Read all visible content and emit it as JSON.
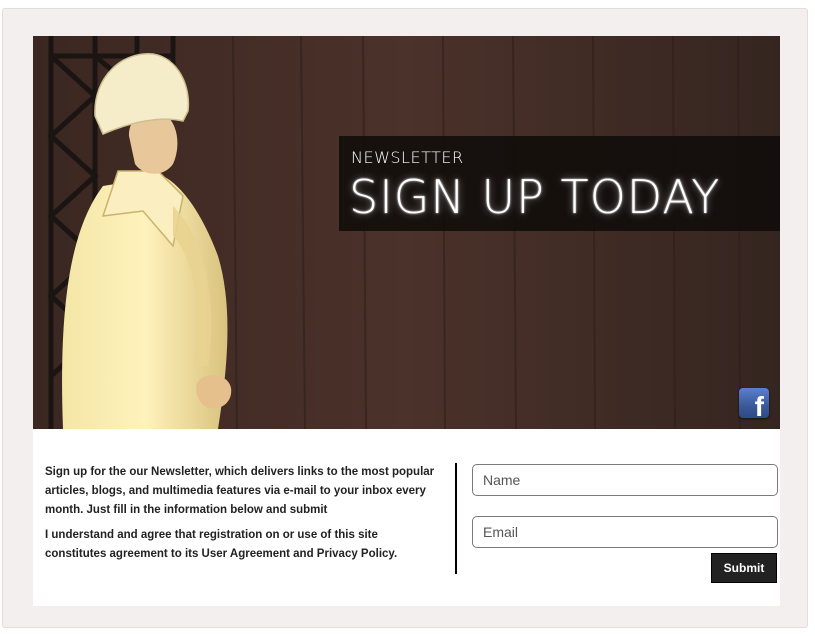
{
  "banner": {
    "kicker": "NEWSLETTER",
    "title": "SIGN UP TODAY"
  },
  "social": {
    "facebook_icon": "facebook-icon",
    "facebook_glyph": "f",
    "color": "#3b5998"
  },
  "info": {
    "paragraph1": "Sign up for the our Newsletter, which delivers links to the most popular articles, blogs, and multimedia features via e-mail to your inbox every month. Just fill in the information below and submit",
    "paragraph2": "I understand and agree that registration on or use of this site constitutes agreement to its User Agreement and Privacy Policy."
  },
  "form": {
    "name_placeholder": "Name",
    "email_placeholder": "Email",
    "submit_label": "Submit"
  },
  "colors": {
    "frame_bg": "#f3efee",
    "hero_bg": "#3f2a23",
    "button_bg": "#222222"
  }
}
